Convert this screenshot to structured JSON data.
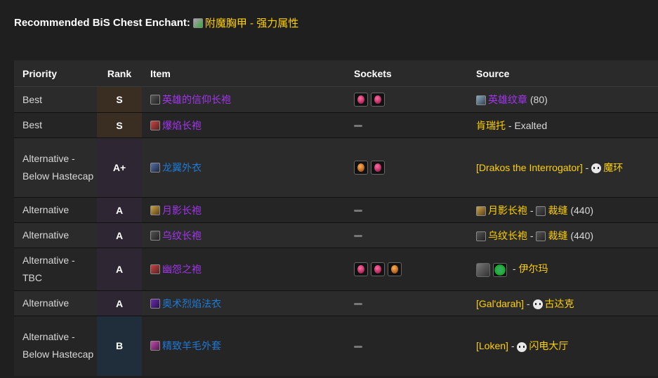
{
  "header": {
    "label": "Recommended BiS Chest Enchant",
    "enchant_name": "附魔胸甲 - 强力属性"
  },
  "table": {
    "columns": [
      "Priority",
      "Rank",
      "Item",
      "Sockets",
      "Source"
    ],
    "rows": [
      {
        "priority": "Best",
        "rank": "S",
        "item": "英雄的信仰长袍",
        "item_quality": "epic",
        "sockets": [
          "red",
          "red"
        ],
        "source": {
          "text": "英雄纹章",
          "suffix": " (80)"
        }
      },
      {
        "priority": "Best",
        "rank": "S",
        "item": "爆焰长袍",
        "item_quality": "epic",
        "sockets": [],
        "source": {
          "text": "肯瑞托",
          "suffix": " - Exalted"
        }
      },
      {
        "priority": "Alternative - Below Hastecap",
        "rank": "A+",
        "item": "龙翼外衣",
        "item_quality": "blue",
        "sockets": [
          "orange",
          "red"
        ],
        "source": {
          "text": "[Drakos the Interrogator]",
          "sep": " - ",
          "instance": "魔环"
        }
      },
      {
        "priority": "Alternative",
        "rank": "A",
        "item": "月影长袍",
        "item_quality": "epic",
        "sockets": [],
        "source": {
          "text": "月影长袍",
          "sep": " - ",
          "profession": "裁缝",
          "suffix": " (440)"
        }
      },
      {
        "priority": "Alternative",
        "rank": "A",
        "item": "乌纹长袍",
        "item_quality": "epic",
        "sockets": [],
        "source": {
          "text": "乌纹长袍",
          "sep": " - ",
          "profession": "裁缝",
          "suffix": " (440)"
        }
      },
      {
        "priority": "Alternative - TBC",
        "rank": "A",
        "item": "幽怨之袍",
        "item_quality": "epic",
        "sockets": [
          "red",
          "red",
          "orange"
        ],
        "source": {
          "sep": " - ",
          "npc": "伊尔玛"
        }
      },
      {
        "priority": "Alternative",
        "rank": "A",
        "item": "奥术烈焰法衣",
        "item_quality": "blue",
        "sockets": [],
        "source": {
          "text": "[Gal'darah]",
          "sep": " - ",
          "instance": "古达克"
        }
      },
      {
        "priority": "Alternative - Below Hastecap",
        "rank": "B",
        "item": "精致羊毛外套",
        "item_quality": "blue",
        "sockets": [],
        "source": {
          "text": "[Loken]",
          "sep": " - ",
          "instance": "闪电大厅"
        }
      }
    ]
  }
}
